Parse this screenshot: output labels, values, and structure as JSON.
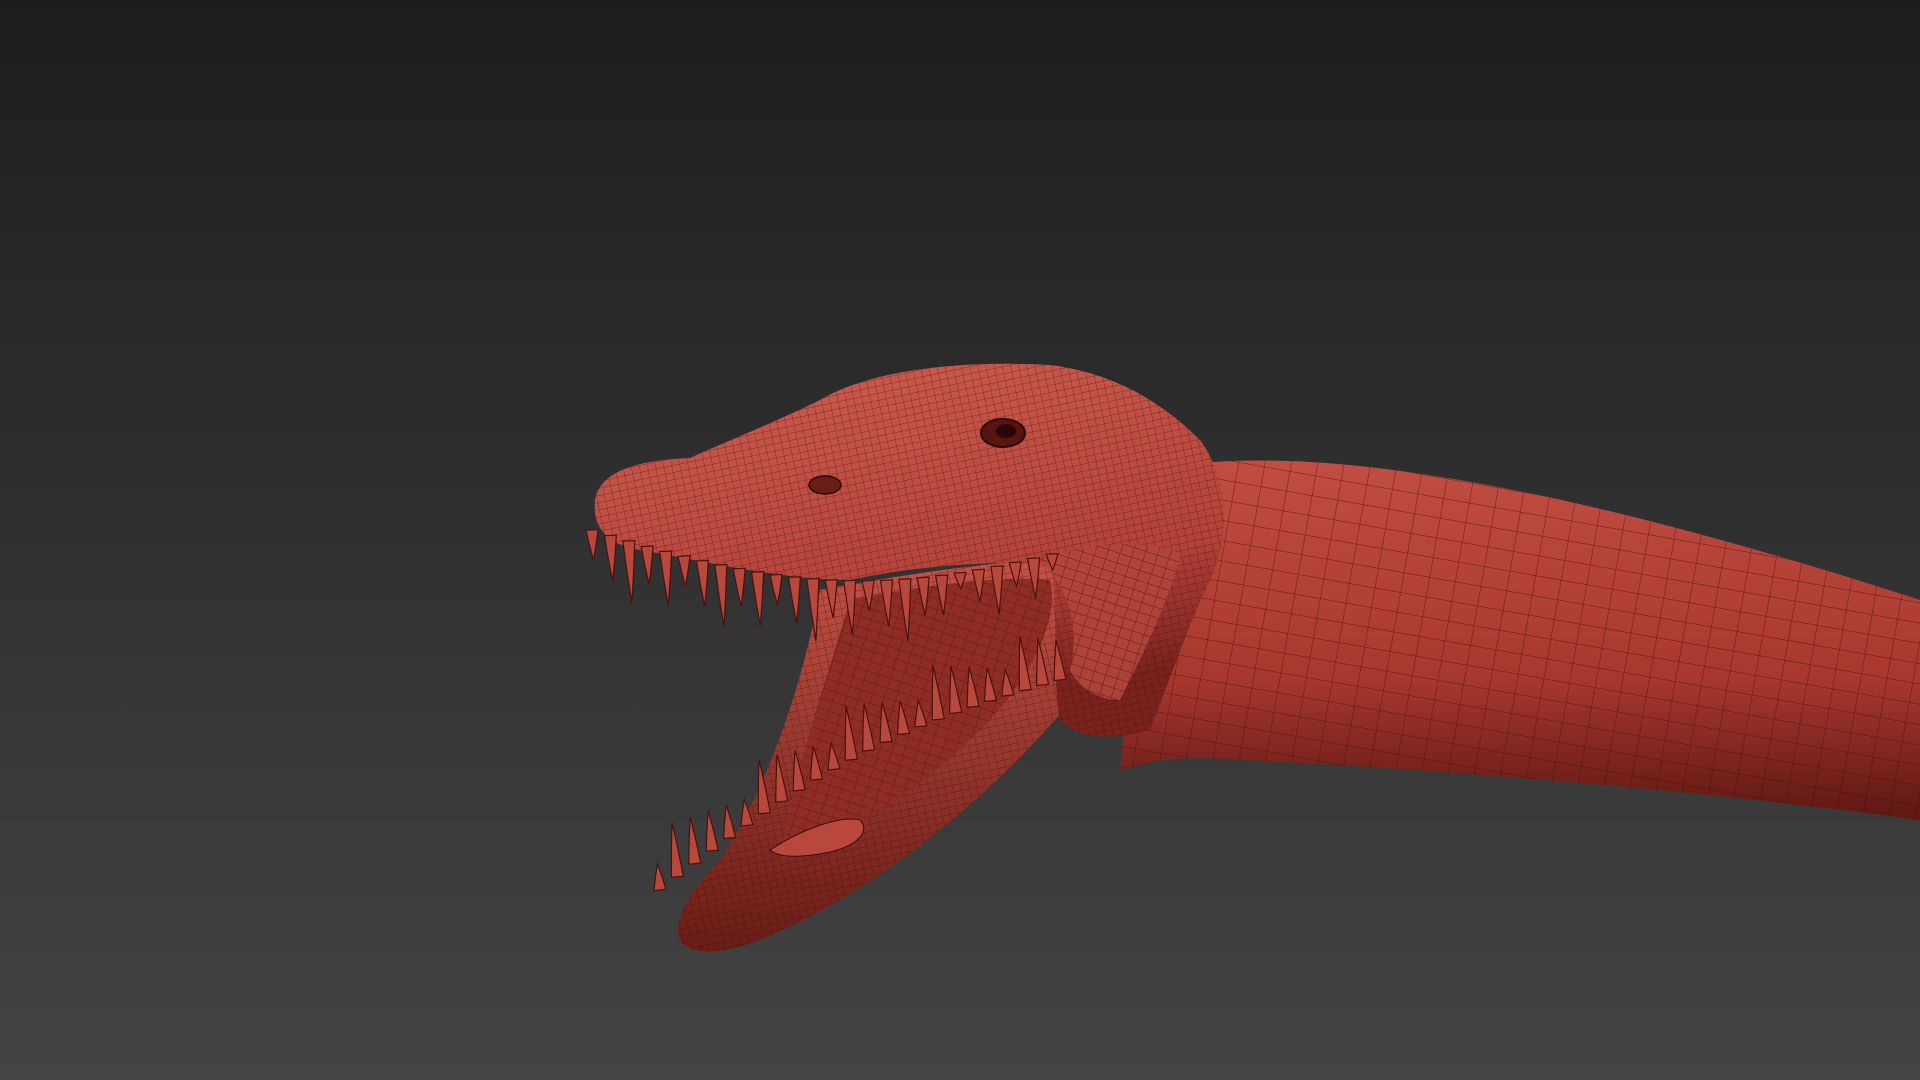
{
  "scene": {
    "subject_icon": "plesiosaur-head-wireframe",
    "colors": {
      "background_top": "#1d1d1d",
      "background_bottom": "#444444",
      "mesh_fill_light": "#c9564a",
      "mesh_fill_mid": "#b13f35",
      "mesh_fill_dark": "#6e1d17",
      "wire": "#3a0d0a",
      "mouth_interior": "#8f2d25",
      "tooth_fill": "#b8473c",
      "tooth_shadow": "#4a110d"
    }
  }
}
